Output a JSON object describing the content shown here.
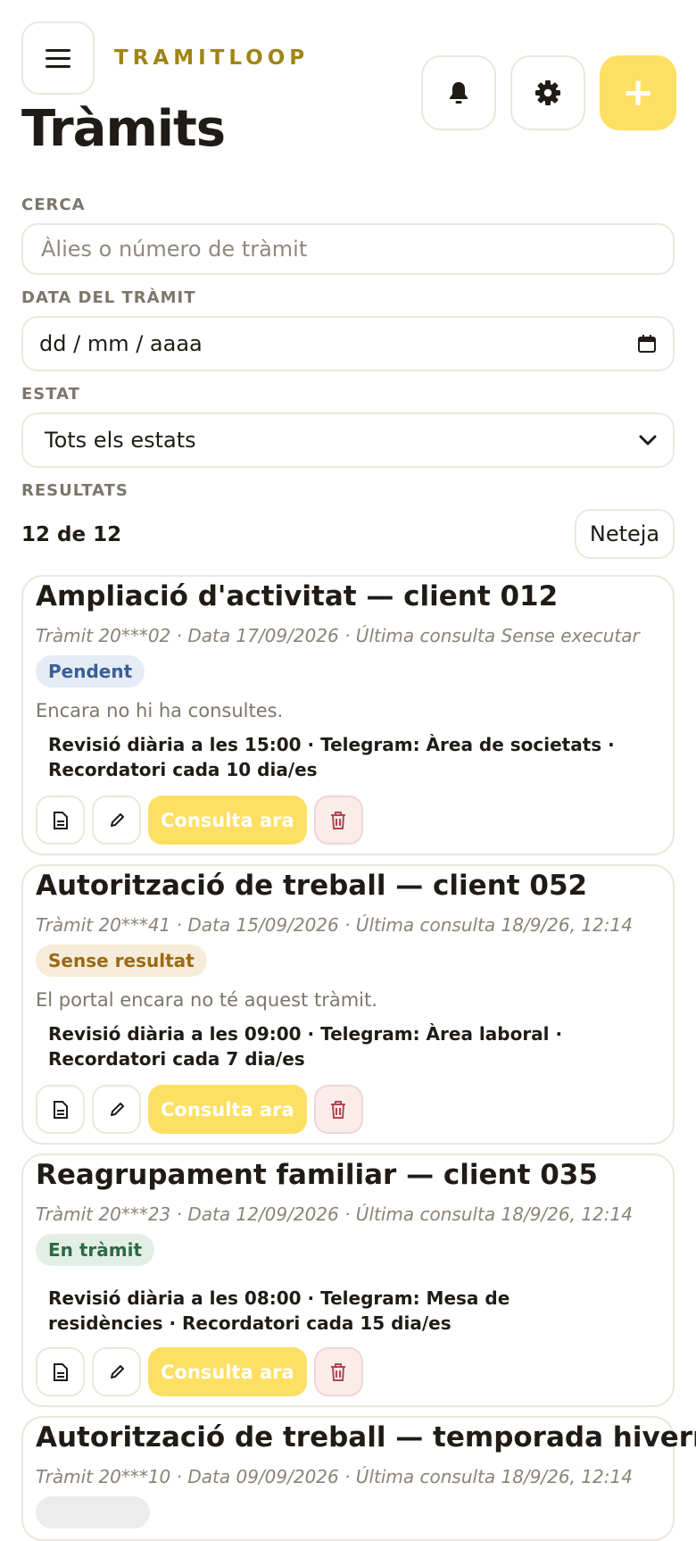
{
  "brand": "TRAMITLOOP",
  "page_title": "Tràmits",
  "filters": {
    "search_label": "CERCA",
    "search_placeholder": "Àlies o número de tràmit",
    "date_label": "DATA DEL TRÀMIT",
    "date_value": "dd / mm / aaaa",
    "status_label": "ESTAT",
    "status_value": "Tots els estats"
  },
  "results": {
    "label": "RESULTATS",
    "count": "12 de 12",
    "clear_label": "Neteja"
  },
  "actions": {
    "consult_label": "Consulta ara"
  },
  "colors": {
    "accent": "#fde063",
    "brand": "#a08515"
  },
  "cards": [
    {
      "title": "Ampliació d'activitat — client 012",
      "meta": "Tràmit 20***02 · Data 17/09/2026 · Última consulta Sense executar",
      "status": "Pendent",
      "note": "Encara no hi ha consultes.",
      "schedule": "Revisió diària a les 15:00 · Telegram: Àrea de societats · Recordatori cada 10 dia/es"
    },
    {
      "title": "Autorització de treball — client 052",
      "meta": "Tràmit 20***41 · Data 15/09/2026 · Última consulta 18/9/26, 12:14",
      "status": "Sense resultat",
      "note": "El portal encara no té aquest tràmit.",
      "schedule": "Revisió diària a les 09:00 · Telegram: Àrea laboral · Recordatori cada 7 dia/es"
    },
    {
      "title": "Reagrupament familiar — client 035",
      "meta": "Tràmit 20***23 · Data 12/09/2026 · Última consulta 18/9/26, 12:14",
      "status": "En tràmit",
      "note": "",
      "schedule": "Revisió diària a les 08:00 · Telegram: Mesa de residències · Recordatori cada 15 dia/es"
    },
    {
      "title": "Autorització de treball — temporada hivern",
      "meta": "Tràmit 20***10 · Data 09/09/2026 · Última consulta 18/9/26, 12:14"
    }
  ]
}
